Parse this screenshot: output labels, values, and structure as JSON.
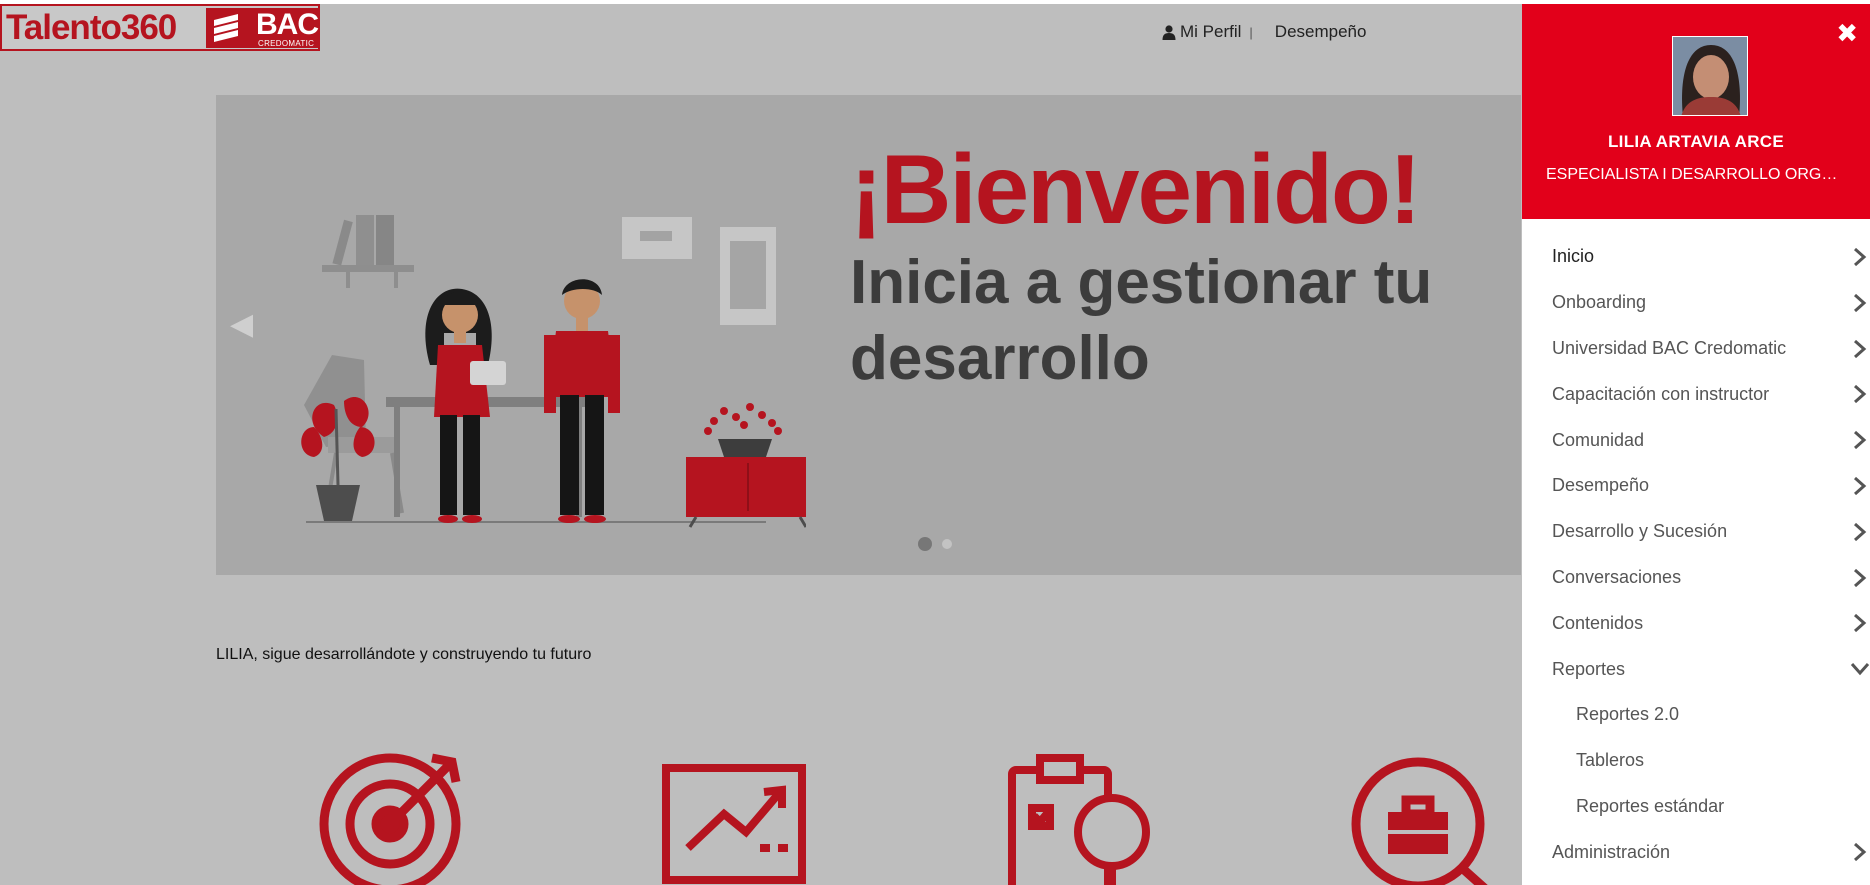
{
  "brand": {
    "name": "Talento360",
    "partner": "BAC",
    "partner_sub": "CREDOMATIC"
  },
  "topnav": {
    "perfil": "Mi Perfil",
    "separator": "|",
    "desempeno": "Desempeño"
  },
  "banner": {
    "title": "¡Bienvenido!",
    "subtitle": "Inicia a gestionar tu desarrollo",
    "slides": 2,
    "active_slide": 1
  },
  "greeting": "LILIA, sigue desarrollándote y construyendo tu futuro",
  "user": {
    "name": "LILIA ARTAVIA ARCE",
    "role": "ESPECIALISTA I DESARROLLO ORGANIZ..."
  },
  "menu": [
    {
      "label": "Inicio"
    },
    {
      "label": "Onboarding"
    },
    {
      "label": "Universidad BAC Credomatic"
    },
    {
      "label": "Capacitación con instructor"
    },
    {
      "label": "Comunidad"
    },
    {
      "label": "Desempeño"
    },
    {
      "label": "Desarrollo y Sucesión"
    },
    {
      "label": "Conversaciones"
    },
    {
      "label": "Contenidos"
    },
    {
      "label": "Reportes"
    }
  ],
  "submenu_reportes": [
    {
      "label": "Reportes 2.0"
    },
    {
      "label": "Tableros"
    },
    {
      "label": "Reportes estándar"
    }
  ],
  "menu_last": {
    "label": "Administración"
  },
  "colors": {
    "brand_red": "#e2001a",
    "dark_red": "#b5141f",
    "background": "#bebebe"
  },
  "icons": [
    "user-icon",
    "close-icon",
    "chevron-right-icon",
    "chevron-down-icon",
    "target-icon",
    "chart-board-icon",
    "clipboard-search-icon",
    "briefcase-search-icon"
  ]
}
